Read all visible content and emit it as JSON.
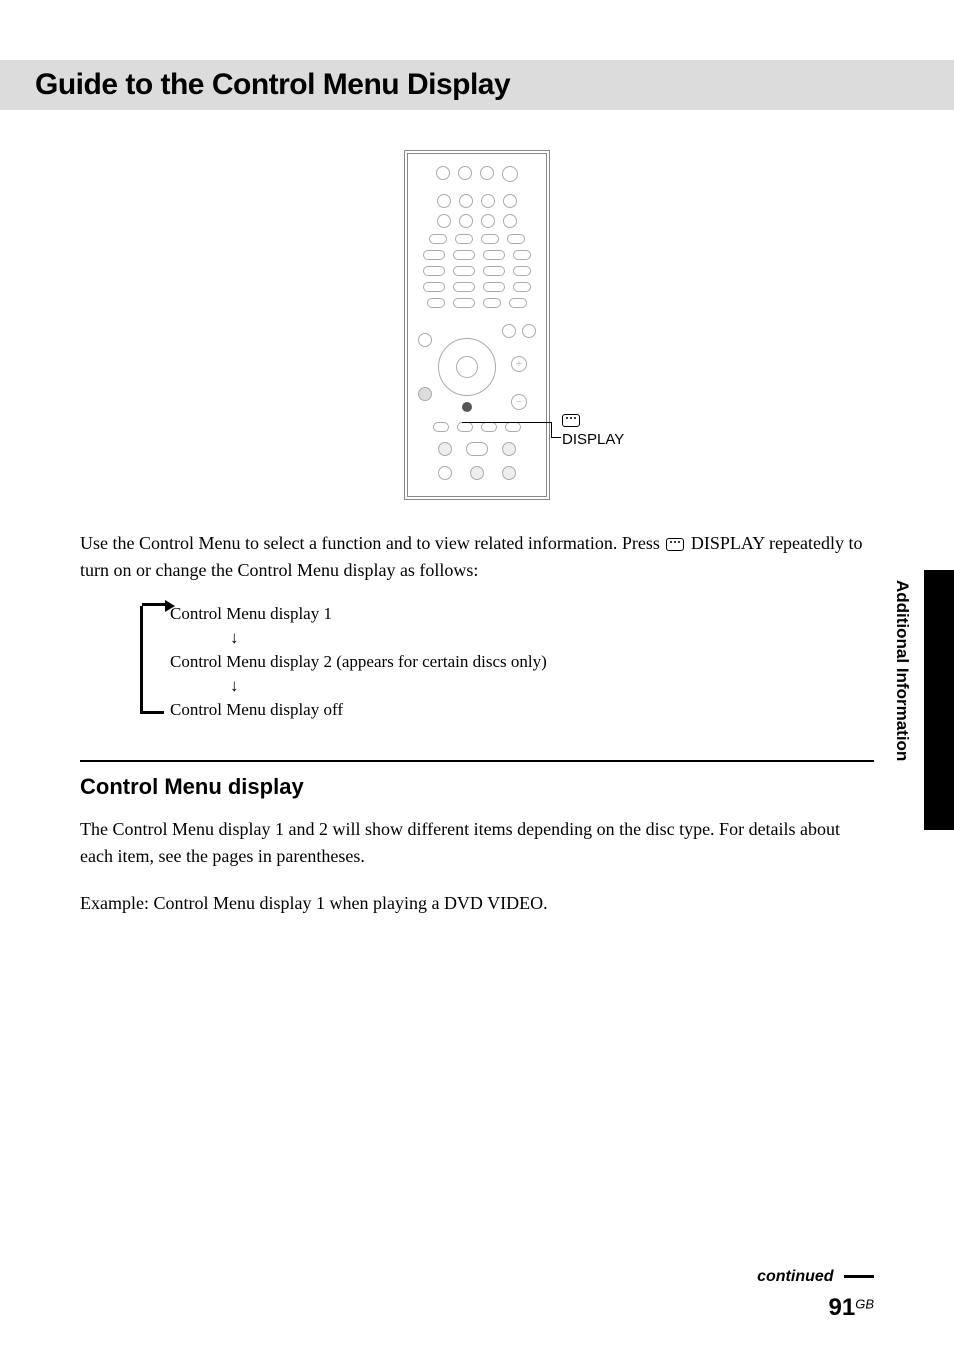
{
  "title": "Guide to the Control Menu Display",
  "callout": {
    "label": "DISPLAY"
  },
  "intro_part1": "Use the Control Menu to select a function and to view related information. Press ",
  "intro_part2": " DISPLAY repeatedly to turn on or change the Control Menu display as follows:",
  "sequence": {
    "item1": "Control Menu display 1",
    "item2": "Control Menu display 2 (appears for certain discs only)",
    "item3": "Control Menu display off"
  },
  "section": {
    "heading": "Control Menu display",
    "body1": "The Control Menu display 1 and 2 will show different items depending on the disc type. For details about each item, see the pages in parentheses.",
    "body2": "Example: Control Menu display 1 when playing a DVD VIDEO."
  },
  "side_label": "Additional Information",
  "footer": {
    "continued": "continued",
    "page_number": "91",
    "page_suffix": "GB"
  }
}
